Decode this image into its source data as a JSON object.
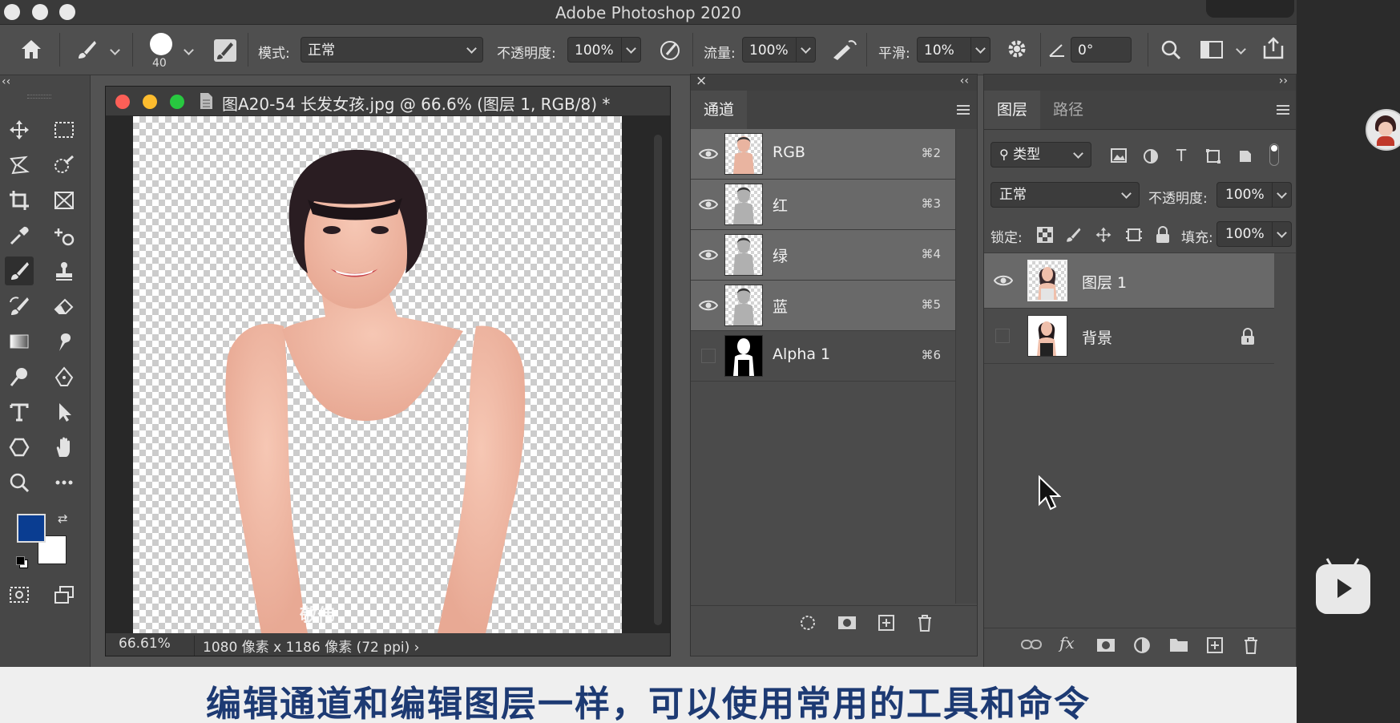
{
  "app": {
    "title": "Adobe Photoshop 2020"
  },
  "options_bar": {
    "brush_size": "40",
    "mode_label": "模式:",
    "mode_value": "正常",
    "opacity_label": "不透明度:",
    "opacity_value": "100%",
    "flow_label": "流量:",
    "flow_value": "100%",
    "smooth_label": "平滑:",
    "smooth_value": "10%",
    "angle_value": "0°"
  },
  "tools": {
    "collapse_label": "‹‹",
    "foreground_color": "#0a3d91",
    "background_color": "#ffffff"
  },
  "document": {
    "title": "图A20-54 长发女孩.jpg @ 66.6% (图层 1, RGB/8) *",
    "zoom": "66.61%",
    "info": "1080 像素 x 1186 像素 (72 ppi)",
    "arrow": "›",
    "watermark": "敬伟"
  },
  "channels_panel": {
    "close_label": "×",
    "collapse_label": "‹‹",
    "tab": "通道",
    "channels": [
      {
        "name": "RGB",
        "shortcut": "⌘2",
        "visible": true,
        "selected": true
      },
      {
        "name": "红",
        "shortcut": "⌘3",
        "visible": true,
        "selected": true
      },
      {
        "name": "绿",
        "shortcut": "⌘4",
        "visible": true,
        "selected": true
      },
      {
        "name": "蓝",
        "shortcut": "⌘5",
        "visible": true,
        "selected": true
      },
      {
        "name": "Alpha 1",
        "shortcut": "⌘6",
        "visible": false,
        "selected": false
      }
    ]
  },
  "layers_panel": {
    "expand_label": "››",
    "tabs": [
      "图层",
      "路径"
    ],
    "filter_label": "类型",
    "blend_mode": "正常",
    "opacity_label": "不透明度:",
    "opacity_value": "100%",
    "lock_label": "锁定:",
    "fill_label": "填充:",
    "fill_value": "100%",
    "layers": [
      {
        "name": "图层 1",
        "visible": true,
        "selected": true,
        "locked": false
      },
      {
        "name": "背景",
        "visible": false,
        "selected": false,
        "locked": true
      }
    ]
  },
  "caption": "编辑通道和编辑图层一样，可以使用常用的工具和命令"
}
